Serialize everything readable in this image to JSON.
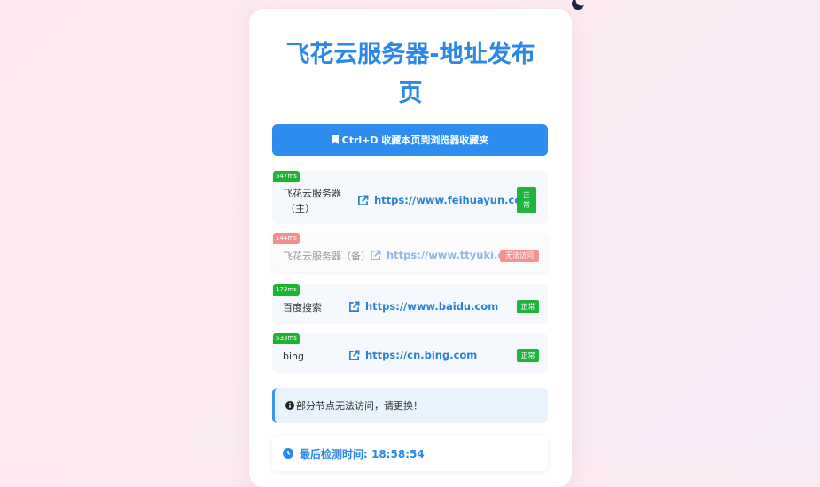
{
  "title": "飞花云服务器-地址发布页",
  "bookmark_button": "Ctrl+D 收藏本页到浏览器收藏夹",
  "sites": [
    {
      "latency": "547ms",
      "name_line1": "飞花云服务器",
      "name_line2": "（主）",
      "url": "https://www.feihuayun.com",
      "status_line1": "正",
      "status_line2": "常"
    },
    {
      "latency": "144ms",
      "name": "飞花云服务器（备）",
      "url": "https://www.ttyuki.cn",
      "status": "无法访问"
    },
    {
      "latency": "173ms",
      "name": "百度搜索",
      "url": "https://www.baidu.com",
      "status": "正常"
    },
    {
      "latency": "533ms",
      "name": "bing",
      "url": "https://cn.bing.com",
      "status": "正常"
    }
  ],
  "notice": "部分节点无法访问，请更换！",
  "last_check": "最后检测时间: 18:58:54",
  "colors": {
    "accent": "#2d8cf0",
    "ok": "#20b33d",
    "error": "#f39393"
  }
}
